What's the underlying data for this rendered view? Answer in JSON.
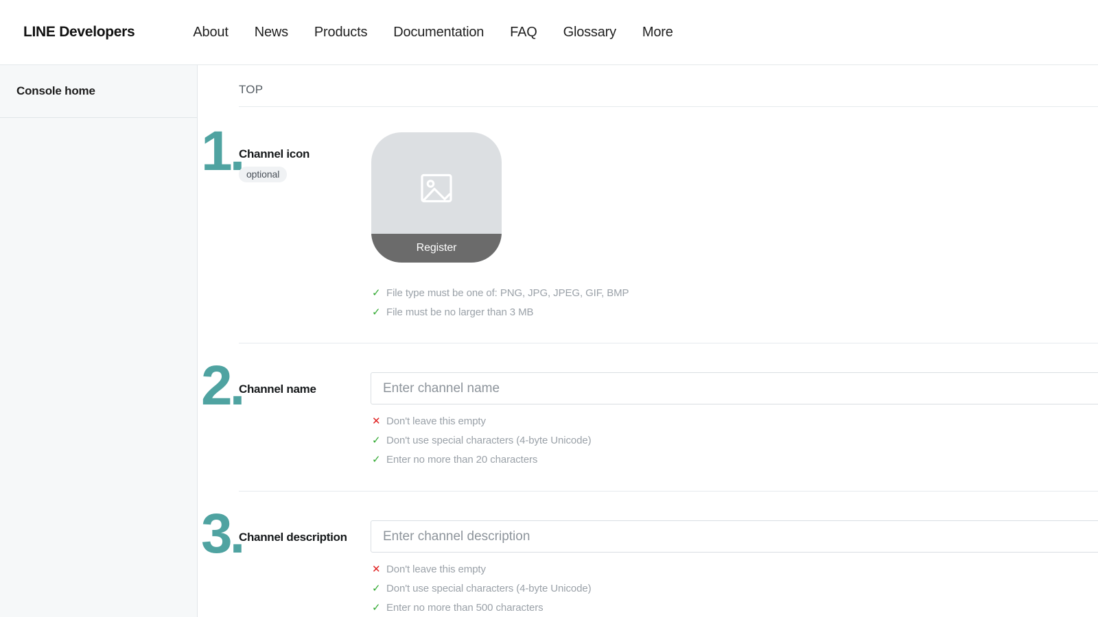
{
  "header": {
    "brand_prefix": "LINE",
    "brand_suffix": "Developers",
    "nav": [
      {
        "label": "About"
      },
      {
        "label": "News"
      },
      {
        "label": "Products"
      },
      {
        "label": "Documentation"
      },
      {
        "label": "FAQ"
      },
      {
        "label": "Glossary"
      },
      {
        "label": "More"
      }
    ]
  },
  "sidebar": {
    "items": [
      {
        "label": "Console home"
      }
    ]
  },
  "main": {
    "breadcrumb": "TOP",
    "steps": [
      {
        "number": "1.",
        "label": "Channel icon",
        "badge": "optional",
        "uploader": {
          "button_label": "Register",
          "icon": "image-placeholder-icon"
        },
        "hints": [
          {
            "status": "ok",
            "mark": "✓",
            "text": "File type must be one of: PNG, JPG, JPEG, GIF, BMP"
          },
          {
            "status": "ok",
            "mark": "✓",
            "text": "File must be no larger than 3 MB"
          }
        ]
      },
      {
        "number": "2.",
        "label": "Channel name",
        "input": {
          "value": "",
          "placeholder": "Enter channel name"
        },
        "hints": [
          {
            "status": "fail",
            "mark": "✕",
            "text": "Don't leave this empty"
          },
          {
            "status": "ok",
            "mark": "✓",
            "text": "Don't use special characters (4-byte Unicode)"
          },
          {
            "status": "ok",
            "mark": "✓",
            "text": "Enter no more than 20 characters"
          }
        ]
      },
      {
        "number": "3.",
        "label": "Channel description",
        "input": {
          "value": "",
          "placeholder": "Enter channel description"
        },
        "hints": [
          {
            "status": "fail",
            "mark": "✕",
            "text": "Don't leave this empty"
          },
          {
            "status": "ok",
            "mark": "✓",
            "text": "Don't use special characters (4-byte Unicode)"
          },
          {
            "status": "ok",
            "mark": "✓",
            "text": "Enter no more than 500 characters"
          }
        ]
      }
    ]
  },
  "colors": {
    "accent_teal": "#4fa3a1",
    "ok_green": "#2fa82f",
    "error_red": "#e02020",
    "uploader_gray": "#dcdfe2",
    "register_bar": "#6b6b6b",
    "sidebar_bg": "#f6f8f9"
  }
}
